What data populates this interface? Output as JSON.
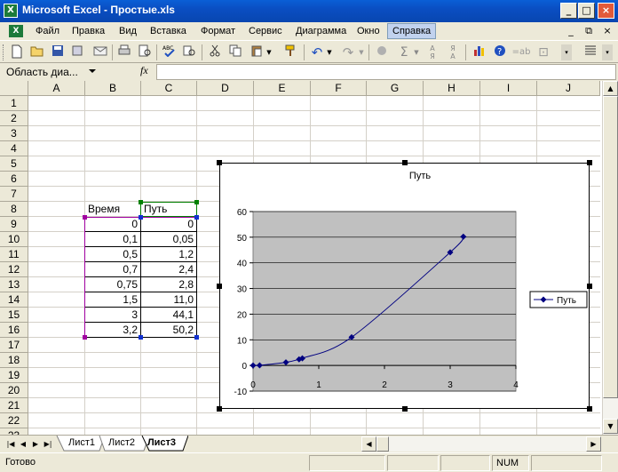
{
  "window": {
    "title": "Microsoft Excel - Простые.xls",
    "minimize": "_",
    "maximize": "□",
    "close": "×"
  },
  "menu": {
    "items": [
      "Файл",
      "Правка",
      "Вид",
      "Вставка",
      "Формат",
      "Сервис",
      "Диаграмма",
      "Окно",
      "Справка"
    ],
    "active": "Справка"
  },
  "toolbar": {
    "icons": [
      "new-icon",
      "open-icon",
      "save-icon",
      "permission-icon",
      "email-icon",
      "print-icon",
      "print-preview-icon",
      "spelling-icon",
      "research-icon",
      "cut-icon",
      "copy-icon",
      "paste-icon",
      "format-painter-icon",
      "undo-icon",
      "redo-icon",
      "hyperlink-icon",
      "autosum-icon",
      "sort-asc-icon",
      "sort-desc-icon",
      "chart-wizard-icon",
      "help-icon"
    ],
    "ab_label": "=ab"
  },
  "formula_bar": {
    "name_box": "Область диа...",
    "fx": "fx",
    "formula": ""
  },
  "grid": {
    "columns": [
      "A",
      "B",
      "C",
      "D",
      "E",
      "F",
      "G",
      "H",
      "I",
      "J"
    ],
    "rows": [
      "1",
      "2",
      "3",
      "4",
      "5",
      "6",
      "7",
      "8",
      "9",
      "10",
      "11",
      "12",
      "13",
      "14",
      "15",
      "16",
      "17",
      "18",
      "19",
      "20",
      "21",
      "22",
      "23"
    ],
    "headers": {
      "time": "Время",
      "path": "Путь"
    },
    "table": [
      [
        "0",
        "0"
      ],
      [
        "0,1",
        "0,05"
      ],
      [
        "0,5",
        "1,2"
      ],
      [
        "0,7",
        "2,4"
      ],
      [
        "0,75",
        "2,8"
      ],
      [
        "1,5",
        "11,0"
      ],
      [
        "3",
        "44,1"
      ],
      [
        "3,2",
        "50,2"
      ]
    ]
  },
  "chart_data": {
    "type": "scatter",
    "title": "Путь",
    "series": [
      {
        "name": "Путь",
        "x": [
          0,
          0.1,
          0.5,
          0.7,
          0.75,
          1.5,
          3,
          3.2
        ],
        "y": [
          0,
          0.05,
          1.2,
          2.4,
          2.8,
          11.0,
          44.1,
          50.2
        ]
      }
    ],
    "xlim": [
      0,
      4
    ],
    "ylim": [
      -10,
      60
    ],
    "xticks": [
      "0",
      "1",
      "2",
      "3",
      "4"
    ],
    "yticks": [
      "-10",
      "0",
      "10",
      "20",
      "30",
      "40",
      "50",
      "60"
    ],
    "plot_area_color": "#c0c0c0",
    "series_color": "#000080",
    "legend": "right",
    "smooth": true
  },
  "tabs": {
    "sheets": [
      "Лист1",
      "Лист2",
      "Лист3"
    ],
    "active": "Лист3"
  },
  "status": {
    "ready": "Готово",
    "num": "NUM"
  }
}
